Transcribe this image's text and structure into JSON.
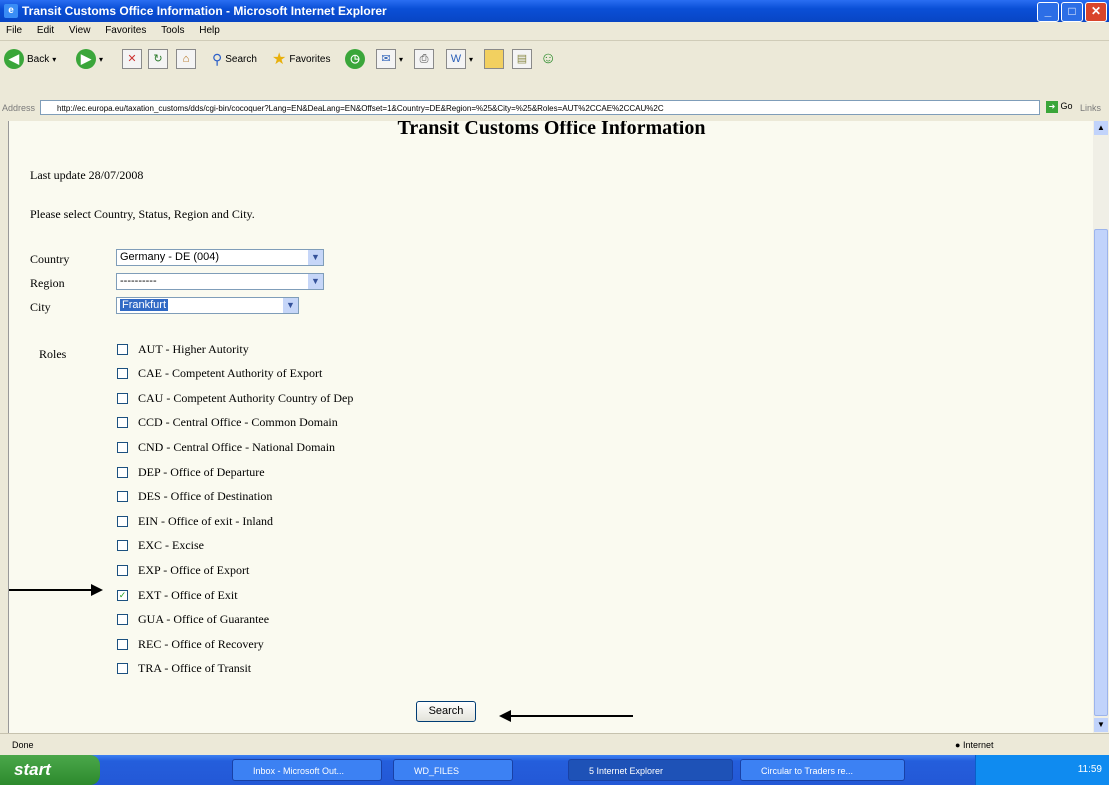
{
  "window": {
    "title": "Transit Customs Office Information - Microsoft Internet Explorer"
  },
  "menu": [
    "File",
    "Edit",
    "View",
    "Favorites",
    "Tools",
    "Help"
  ],
  "toolbar": {
    "back": "Back",
    "search": "Search",
    "favorites": "Favorites"
  },
  "address": {
    "label": "Address",
    "url": "http://ec.europa.eu/taxation_customs/dds/cgi-bin/cocoquer?Lang=EN&DeaLang=EN&Offset=1&Country=DE&Region=%25&City=%25&Roles=AUT%2CCAE%2CCAU%2C",
    "go": "Go",
    "links": "Links"
  },
  "page": {
    "title": "Transit Customs Office Information",
    "last_update": "Last update 28/07/2008",
    "instruction": "Please select Country, Status, Region and City.",
    "country_label": "Country",
    "country_value": "Germany - DE (004)",
    "region_label": "Region",
    "region_value": "----------",
    "city_label": "City",
    "city_value": "Frankfurt",
    "roles_label": "Roles",
    "roles": [
      {
        "label": "AUT - Higher Autority",
        "checked": false
      },
      {
        "label": "CAE - Competent Authority of Export",
        "checked": false
      },
      {
        "label": "CAU - Competent Authority Country of Dep",
        "checked": false
      },
      {
        "label": "CCD - Central Office - Common Domain",
        "checked": false
      },
      {
        "label": "CND - Central Office - National Domain",
        "checked": false
      },
      {
        "label": "DEP - Office of Departure",
        "checked": false
      },
      {
        "label": "DES - Office of Destination",
        "checked": false
      },
      {
        "label": "EIN - Office of exit - Inland",
        "checked": false
      },
      {
        "label": "EXC - Excise",
        "checked": false
      },
      {
        "label": "EXP - Office of Export",
        "checked": false
      },
      {
        "label": "EXT - Office of Exit",
        "checked": true
      },
      {
        "label": "GUA - Office of Guarantee",
        "checked": false
      },
      {
        "label": "REC - Office of Recovery",
        "checked": false
      },
      {
        "label": "TRA - Office of Transit",
        "checked": false
      }
    ],
    "search_button": "Search"
  },
  "status": {
    "text": "Done",
    "zone": "Internet"
  },
  "taskbar": {
    "start": "start",
    "tasks": [
      "Inbox - Microsoft Out...",
      "WD_FILES",
      "5 Internet Explorer",
      "Circular to Traders re..."
    ],
    "clock": "11:59"
  },
  "colors": {
    "titlebar": "#0a4fd6",
    "page_bg": "#fafaf0",
    "selection": "#316ac5",
    "taskbar": "#245edc",
    "start": "#2d8a2d"
  }
}
